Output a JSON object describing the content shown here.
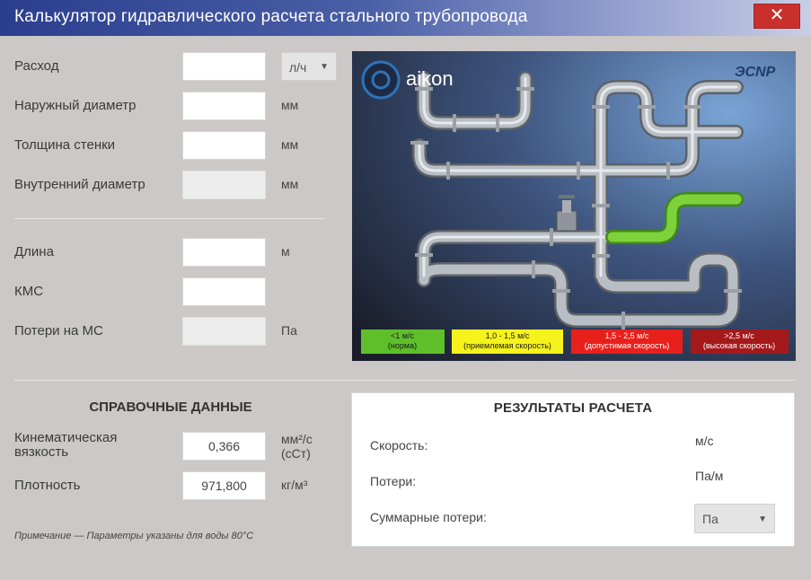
{
  "window": {
    "title": "Калькулятор гидравлического расчета стального трубопровода",
    "close_label": "✕"
  },
  "inputs": {
    "flow": {
      "label": "Расход",
      "value": "",
      "unit_options_selected": "л/ч"
    },
    "outer_diameter": {
      "label": "Наружный диаметр",
      "value": "",
      "unit": "мм"
    },
    "wall_thickness": {
      "label": "Толщина стенки",
      "value": "",
      "unit": "мм"
    },
    "inner_diameter": {
      "label": "Внутренний диаметр",
      "value": "",
      "unit": "мм"
    },
    "length": {
      "label": "Длина",
      "value": "",
      "unit": "м"
    },
    "kms": {
      "label": "КМС",
      "value": ""
    },
    "local_losses": {
      "label": "Потери на МС",
      "value": "",
      "unit": "Па"
    }
  },
  "scheme": {
    "logo_text": "aikon",
    "brand_text": "ЭCNP",
    "legend": [
      {
        "line1": "<1 м/с",
        "line2": "(норма)",
        "color": "#5fbf2a",
        "text_color": "#1a1a1a"
      },
      {
        "line1": "1,0 - 1,5 м/с",
        "line2": "(приемлемая скорость)",
        "color": "#f6f21c",
        "text_color": "#1a1a1a"
      },
      {
        "line1": "1,5 - 2,5 м/с",
        "line2": "(допустимая скорость)",
        "color": "#e8201c",
        "text_color": "#ffffff"
      },
      {
        "line1": ">2,5 м/с",
        "line2": "(высокая скорость)",
        "color": "#a5191b",
        "text_color": "#ffffff"
      }
    ]
  },
  "reference": {
    "title": "СПРАВОЧНЫЕ ДАННЫЕ",
    "viscosity": {
      "label_line1": "Кинематическая",
      "label_line2": "вязкость",
      "value": "0,366",
      "unit_line1": "мм²/с",
      "unit_line2": "(сСт)"
    },
    "density": {
      "label": "Плотность",
      "value": "971,800",
      "unit": "кг/м³"
    },
    "note": "Примечание — Параметры указаны для воды 80°С"
  },
  "results": {
    "title": "РЕЗУЛЬТАТЫ РАСЧЕТА",
    "speed": {
      "label": "Скорость:",
      "unit": "м/с"
    },
    "losses": {
      "label": "Потери:",
      "unit": "Па/м"
    },
    "total_losses": {
      "label": "Суммарные потери:",
      "unit_selected": "Па"
    }
  },
  "colors": {
    "titlebar": "#2b3e8e",
    "close": "#c9302c",
    "green_pipe": "#6cc02a"
  }
}
